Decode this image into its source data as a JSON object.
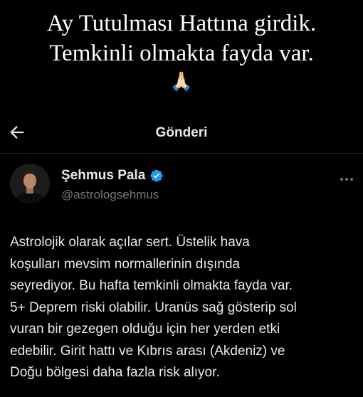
{
  "caption": {
    "line1": "Ay Tutulması Hattına girdik.",
    "line2": "Temkinli olmakta fayda var.",
    "emoji": "🙏🏻"
  },
  "header": {
    "back_icon": "back-arrow-icon",
    "title": "Gönderi"
  },
  "post": {
    "author": {
      "name": "Şehmus Pala",
      "handle": "@astrologsehmus",
      "verified_color": "#1d9bf0"
    },
    "more_icon": "more-dots-icon",
    "text": "Astrolojik olarak açılar sert. Üstelik hava\nkoşulları mevsim normallerinin dışında\nseyrediyor.  Bu hafta temkinli olmakta fayda var.\n5+ Deprem riski olabilir.  Uranüs sağ gösterip sol\nvuran bir gezegen olduğu için her yerden etki\nedebilir. Girit hattı ve Kıbrıs arası (Akdeniz) ve\nDoğu bölgesi daha fazla risk alıyor."
  },
  "colors": {
    "background": "#000000",
    "text": "#e7e9ea",
    "secondary_text": "#71767b",
    "divider": "#1f2326"
  }
}
